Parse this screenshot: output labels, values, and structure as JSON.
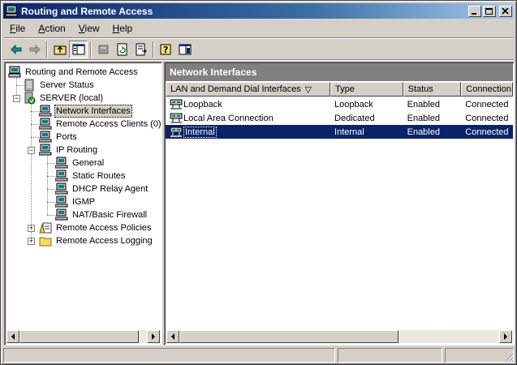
{
  "window": {
    "title": "Routing and Remote Access",
    "colors": {
      "titlebar_start": "#0a246a",
      "titlebar_end": "#a6caf0",
      "selection": "#0a246a",
      "face": "#d4d0c8"
    }
  },
  "menu": {
    "file": {
      "hot": "F",
      "rest": "ile"
    },
    "action": {
      "hot": "A",
      "rest": "ction"
    },
    "view": {
      "hot": "V",
      "rest": "iew"
    },
    "help": {
      "hot": "H",
      "rest": "elp"
    }
  },
  "toolbar": {
    "icons": [
      "back-arrow-icon",
      "forward-arrow-icon",
      "up-folder-icon",
      "show-hide-tree-icon",
      "properties-icon",
      "refresh-icon",
      "export-list-icon",
      "help-icon",
      "console-tree-icon"
    ]
  },
  "tree": {
    "root": "Routing and Remote Access",
    "server_status": "Server Status",
    "server": "SERVER (local)",
    "network_interfaces": "Network Interfaces",
    "remote_access_clients": "Remote Access Clients (0)",
    "ports": "Ports",
    "ip_routing": "IP Routing",
    "general": "General",
    "static_routes": "Static Routes",
    "dhcp_relay_agent": "DHCP Relay Agent",
    "igmp": "IGMP",
    "nat_firewall": "NAT/Basic Firewall",
    "remote_access_policies": "Remote Access Policies",
    "remote_access_logging": "Remote Access Logging",
    "selected": "network_interfaces"
  },
  "list": {
    "title": "Network Interfaces",
    "columns": [
      "LAN and Demand Dial Interfaces",
      "Type",
      "Status",
      "Connection"
    ],
    "sort_indicator": "▽",
    "rows": [
      {
        "name": "Loopback",
        "type": "Loopback",
        "status": "Enabled",
        "connection": "Connected"
      },
      {
        "name": "Local Area Connection",
        "type": "Dedicated",
        "status": "Enabled",
        "connection": "Connected"
      },
      {
        "name": "Internal",
        "type": "Internal",
        "status": "Enabled",
        "connection": "Connected",
        "selected": true
      }
    ]
  }
}
